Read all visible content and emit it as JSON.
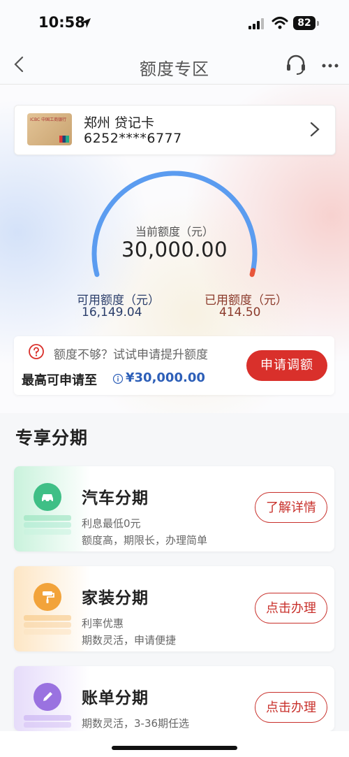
{
  "status": {
    "time": "10:58",
    "battery": "82"
  },
  "nav": {
    "title": "额度专区",
    "back_icon": "chevron-left-icon",
    "service_icon": "headset-icon",
    "more_icon": "more-dots-icon"
  },
  "card": {
    "name": "郑州 贷记卡",
    "number": "6252****6777",
    "thumb_bank": "ICBC 中国工商银行"
  },
  "credit": {
    "current_label": "当前额度（元）",
    "current_value": "30,000.00",
    "available_label": "可用额度（元）",
    "available_value": "16,149.04",
    "used_label": "已用额度（元）",
    "used_value": "414.50",
    "used_fraction": 0.0138,
    "gauge_colors": {
      "available": "#5b9cf0",
      "used": "#e8553a"
    }
  },
  "increase": {
    "hint": "额度不够？试试申请提升额度",
    "max_label": "最高可申请至",
    "max_value": "¥30,000.00",
    "apply_button": "申请调额"
  },
  "section": {
    "title": "专享分期"
  },
  "plans": [
    {
      "title": "汽车分期",
      "desc1": "利息最低0元",
      "desc2": "额度高，期限长，办理简单",
      "button": "了解详情",
      "icon": "car-icon",
      "color": "#3fbf86",
      "glow": "#c9f2dc"
    },
    {
      "title": "家装分期",
      "desc1": "利率优惠",
      "desc2": "期数灵活，申请便捷",
      "button": "点击办理",
      "icon": "paint-roller-icon",
      "color": "#f2a33a",
      "glow": "#fde6c5"
    },
    {
      "title": "账单分期",
      "desc1": "期数灵活，3-36期任选",
      "desc2": "",
      "button": "点击办理",
      "icon": "pencil-icon",
      "color": "#9a72e0",
      "glow": "#e6dcfa"
    }
  ]
}
